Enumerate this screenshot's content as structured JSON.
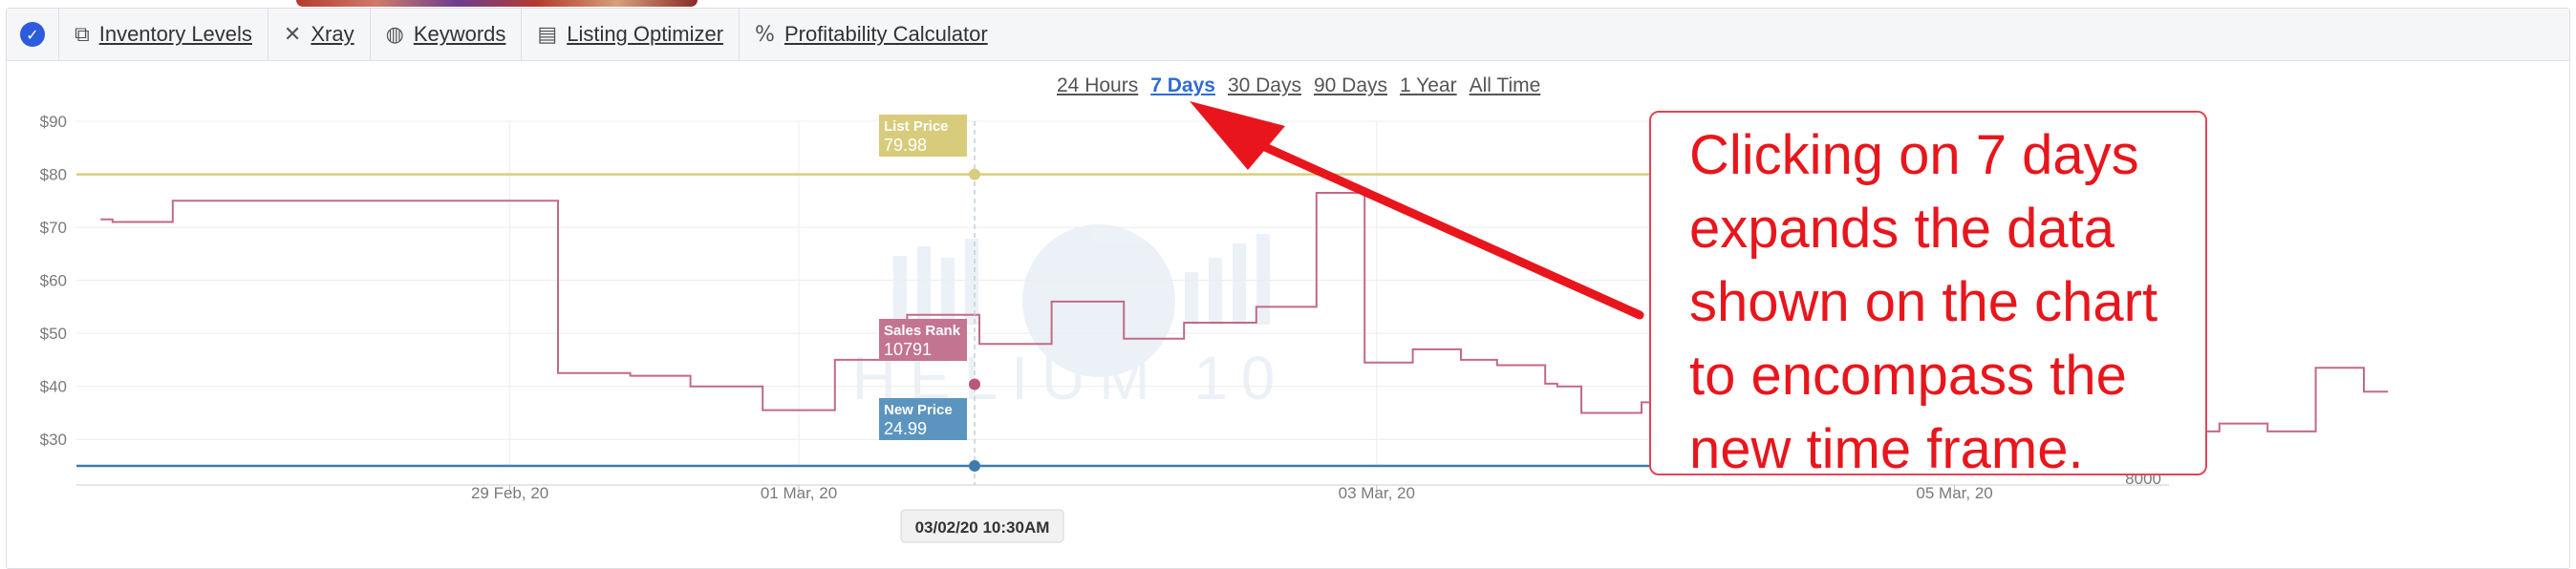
{
  "toolbar": {
    "items": [
      {
        "label": "Inventory Levels",
        "icon": "copy-icon"
      },
      {
        "label": "Xray",
        "icon": "x-icon"
      },
      {
        "label": "Keywords",
        "icon": "globe-icon"
      },
      {
        "label": "Listing Optimizer",
        "icon": "document-icon"
      },
      {
        "label": "Profitability Calculator",
        "icon": "percent-icon"
      }
    ]
  },
  "ranges": [
    "24 Hours",
    "7 Days",
    "30 Days",
    "90 Days",
    "1 Year",
    "All Time"
  ],
  "active_range": "7 Days",
  "chart_data": {
    "type": "line",
    "y_axis": {
      "ticks": [
        "$90",
        "$80",
        "$70",
        "$60",
        "$50",
        "$40",
        "$30"
      ],
      "range": [
        25,
        90
      ]
    },
    "y2_axis": {
      "visible_tick": "8000"
    },
    "x_axis": {
      "ticks": [
        "29 Feb, 20",
        "01 Mar, 20",
        "03 Mar, 20",
        "05 Mar, 20"
      ]
    },
    "series": [
      {
        "name": "List Price",
        "color": "#d9cd7e",
        "values": [
          79.98
        ]
      },
      {
        "name": "Sales Rank",
        "color": "#c16a88",
        "steps": [
          {
            "x": "2020-02-28T02:00",
            "y": 71.5
          },
          {
            "x": "2020-02-28T03:00",
            "y": 71
          },
          {
            "x": "2020-02-28T08:00",
            "y": 75
          },
          {
            "x": "2020-02-29T16:00",
            "y": 42.5
          },
          {
            "x": "2020-02-29T22:00",
            "y": 42
          },
          {
            "x": "2020-03-01T03:00",
            "y": 40
          },
          {
            "x": "2020-03-01T09:00",
            "y": 35.5
          },
          {
            "x": "2020-03-01T15:00",
            "y": 45
          },
          {
            "x": "2020-03-01T21:00",
            "y": 53.5
          },
          {
            "x": "2020-03-02T03:00",
            "y": 48
          },
          {
            "x": "2020-03-02T09:00",
            "y": 56
          },
          {
            "x": "2020-03-02T15:00",
            "y": 49
          },
          {
            "x": "2020-03-02T20:00",
            "y": 52
          },
          {
            "x": "2020-03-03T02:00",
            "y": 55
          },
          {
            "x": "2020-03-03T07:00",
            "y": 76.5
          },
          {
            "x": "2020-03-03T11:00",
            "y": 44.5
          },
          {
            "x": "2020-03-03T15:00",
            "y": 47
          },
          {
            "x": "2020-03-03T19:00",
            "y": 45
          },
          {
            "x": "2020-03-03T22:00",
            "y": 44
          },
          {
            "x": "2020-03-04T02:00",
            "y": 40.5
          },
          {
            "x": "2020-03-04T03:00",
            "y": 40
          },
          {
            "x": "2020-03-04T05:00",
            "y": 35
          },
          {
            "x": "2020-03-04T10:00",
            "y": 37
          },
          {
            "x": "2020-03-04T15:00",
            "y": 51
          },
          {
            "x": "2020-03-04T20:00",
            "y": 44.5
          },
          {
            "x": "2020-03-05T01:00",
            "y": 51
          },
          {
            "x": "2020-03-05T06:00",
            "y": 33.5
          },
          {
            "x": "2020-03-05T13:00",
            "y": 34
          },
          {
            "x": "2020-03-05T21:00",
            "y": 29
          },
          {
            "x": "2020-03-06T04:00",
            "y": 31.5
          },
          {
            "x": "2020-03-06T10:00",
            "y": 33
          },
          {
            "x": "2020-03-06T14:00",
            "y": 31.5
          },
          {
            "x": "2020-03-06T18:00",
            "y": 43.5
          },
          {
            "x": "2020-03-06T22:00",
            "y": 39
          },
          {
            "x": "2020-03-07T00:00",
            "y": 39
          }
        ]
      },
      {
        "name": "New Price",
        "color": "#3f7aad",
        "values": [
          24.99
        ]
      }
    ],
    "tooltip": {
      "date": "03/02/20 10:30AM",
      "list_price_label": "List Price",
      "list_price_value": "79.98",
      "sales_rank_label": "Sales Rank",
      "sales_rank_value": "10791",
      "new_price_label": "New Price",
      "new_price_value": "24.99"
    },
    "watermark": "HELIUM 10",
    "grid": true
  },
  "annotation": {
    "lines": [
      "Clicking on 7 days",
      "expands the data",
      "shown on the chart",
      "to encompass the",
      "new time frame."
    ],
    "color": "#e8161c"
  }
}
